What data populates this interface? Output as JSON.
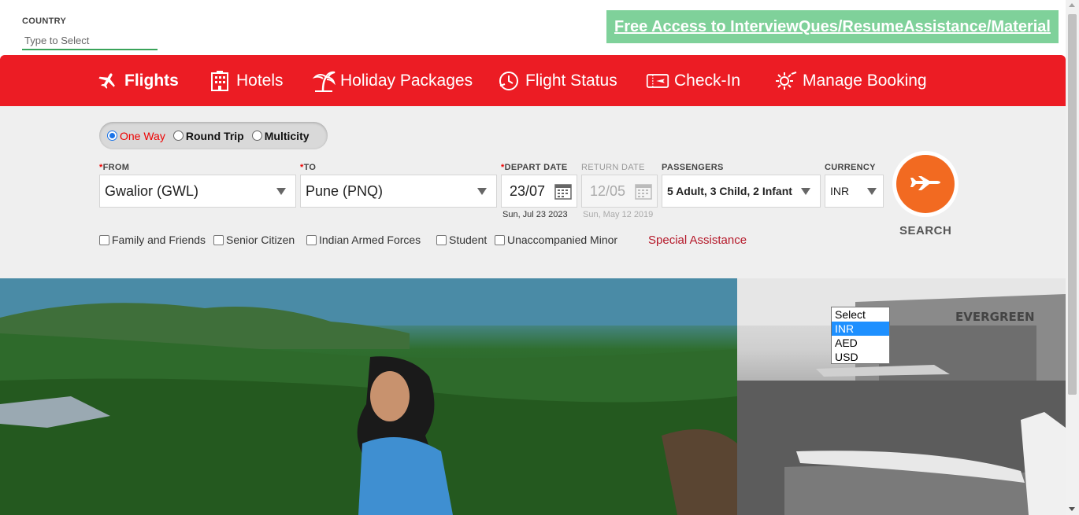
{
  "country": {
    "label": "COUNTRY",
    "placeholder": "Type to Select"
  },
  "promo": {
    "text": "Free Access to InterviewQues/ResumeAssistance/Material"
  },
  "nav": {
    "items": [
      {
        "label": "Flights",
        "icon": "plane-icon"
      },
      {
        "label": "Hotels",
        "icon": "hotel-icon"
      },
      {
        "label": "Holiday Packages",
        "icon": "palm-icon"
      },
      {
        "label": "Flight Status",
        "icon": "clock-plane-icon"
      },
      {
        "label": "Check-In",
        "icon": "ticket-icon"
      },
      {
        "label": "Manage Booking",
        "icon": "gear-icon"
      }
    ]
  },
  "trip": {
    "one_way": "One Way",
    "round_trip": "Round Trip",
    "multicity": "Multicity",
    "selected": "One Way"
  },
  "form": {
    "from_label": "FROM",
    "from_value": "Gwalior (GWL)",
    "to_label": "TO",
    "to_value": "Pune (PNQ)",
    "depart_label": "DEPART DATE",
    "depart_value": "23/07",
    "depart_sub": "Sun, Jul 23 2023",
    "return_label": "RETURN DATE",
    "return_value": "12/05",
    "return_sub": "Sun, May 12 2019",
    "pax_label": "PASSENGERS",
    "pax_value": "5 Adult, 3 Child, 2 Infant",
    "currency_label": "CURRENCY",
    "currency_value": "INR",
    "required_mark": "*"
  },
  "search": {
    "label": "SEARCH"
  },
  "concessions": {
    "items": [
      "Family and Friends",
      "Senior Citizen",
      "Indian Armed Forces",
      "Student",
      "Unaccompanied Minor"
    ],
    "special": "Special Assistance"
  },
  "currency_dropdown": {
    "options": [
      "Select",
      "INR",
      "AED",
      "USD"
    ],
    "highlighted": "INR"
  },
  "hero": {
    "right_sign": "EVERGREEN"
  },
  "colors": {
    "brand_red": "#ec1c24",
    "search_orange": "#f26a21",
    "promo_green": "#7fd19a"
  }
}
